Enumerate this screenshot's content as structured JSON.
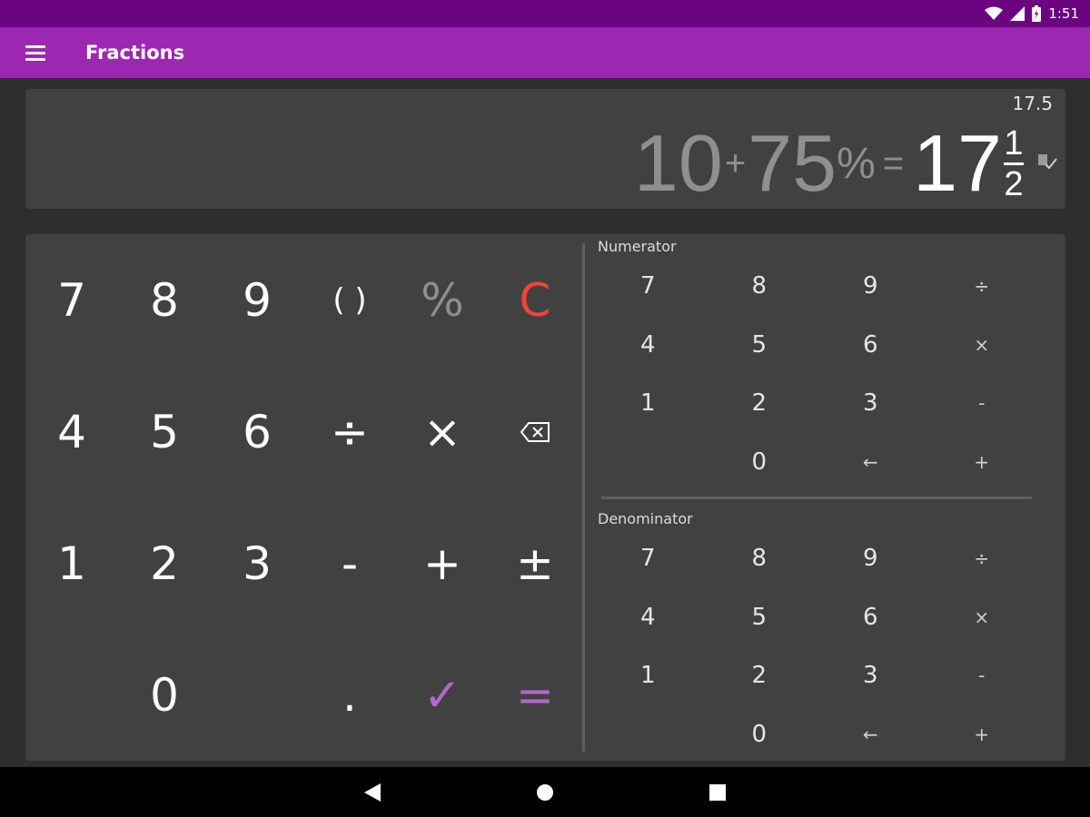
{
  "status_bar": {
    "time": "1:51"
  },
  "app_bar": {
    "title": "Fractions"
  },
  "display": {
    "decimal_result": "17.5",
    "expression": {
      "operand1": "10",
      "operator": "+",
      "operand2": "75",
      "percent": "%",
      "equals": "=",
      "result_whole": "17",
      "result_numerator": "1",
      "result_denominator": "2"
    }
  },
  "main_keypad": {
    "keys": [
      {
        "label": "7",
        "name": "key-7",
        "style": ""
      },
      {
        "label": "8",
        "name": "key-8",
        "style": ""
      },
      {
        "label": "9",
        "name": "key-9",
        "style": ""
      },
      {
        "label": "( )",
        "name": "key-parentheses",
        "style": "small"
      },
      {
        "label": "%",
        "name": "key-percent",
        "style": "gray"
      },
      {
        "label": "C",
        "name": "key-clear",
        "style": "red"
      },
      {
        "label": "4",
        "name": "key-4",
        "style": ""
      },
      {
        "label": "5",
        "name": "key-5",
        "style": ""
      },
      {
        "label": "6",
        "name": "key-6",
        "style": ""
      },
      {
        "label": "÷",
        "name": "key-divide",
        "style": ""
      },
      {
        "label": "×",
        "name": "key-multiply",
        "style": ""
      },
      {
        "label": "",
        "name": "key-backspace",
        "style": "backspace"
      },
      {
        "label": "1",
        "name": "key-1",
        "style": ""
      },
      {
        "label": "2",
        "name": "key-2",
        "style": ""
      },
      {
        "label": "3",
        "name": "key-3",
        "style": ""
      },
      {
        "label": "-",
        "name": "key-subtract",
        "style": ""
      },
      {
        "label": "+",
        "name": "key-add",
        "style": ""
      },
      {
        "label": "±",
        "name": "key-plus-minus",
        "style": ""
      },
      {
        "label": "",
        "name": "key-empty",
        "style": "empty"
      },
      {
        "label": "0",
        "name": "key-0",
        "style": ""
      },
      {
        "label": "",
        "name": "key-empty",
        "style": "empty"
      },
      {
        "label": ".",
        "name": "key-decimal",
        "style": ""
      },
      {
        "label": "✓",
        "name": "key-check",
        "style": "purple"
      },
      {
        "label": "=",
        "name": "key-equals",
        "style": "purple"
      }
    ]
  },
  "numerator_pad": {
    "label": "Numerator",
    "keys": [
      "7",
      "8",
      "9",
      "÷",
      "4",
      "5",
      "6",
      "×",
      "1",
      "2",
      "3",
      "-",
      "",
      "0",
      "←",
      "+"
    ]
  },
  "denominator_pad": {
    "label": "Denominator",
    "keys": [
      "7",
      "8",
      "9",
      "÷",
      "4",
      "5",
      "6",
      "×",
      "1",
      "2",
      "3",
      "-",
      "",
      "0",
      "←",
      "+"
    ]
  },
  "colors": {
    "status_bar": "#6a047f",
    "app_bar": "#9c27b0",
    "clear": "#f44336",
    "accent": "#b566cc"
  },
  "icons": {
    "menu": "hamburger-icon",
    "backspace": "backspace-icon",
    "copy": "copy-check-icon",
    "nav_back": "back-triangle-icon",
    "nav_home": "home-circle-icon",
    "nav_recents": "recents-square-icon"
  }
}
